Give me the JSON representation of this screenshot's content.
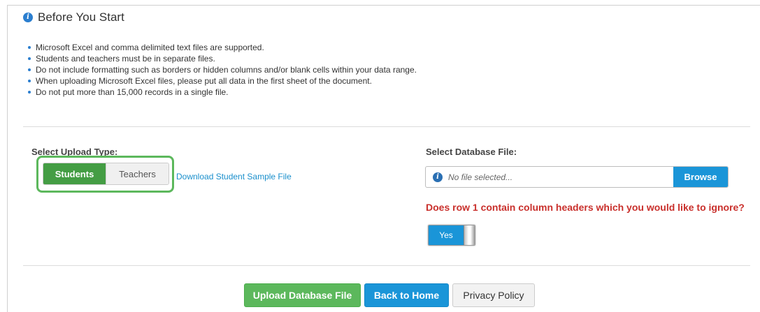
{
  "header": {
    "title": "Before You Start",
    "icon": "info-icon"
  },
  "notes": [
    "Microsoft Excel and comma delimited text files are supported.",
    "Students and teachers must be in separate files.",
    "Do not include formatting such as borders or hidden columns and/or blank cells within your data range.",
    "When uploading Microsoft Excel files, please put all data in the first sheet of the document.",
    "Do not put more than 15,000 records in a single file."
  ],
  "upload_type": {
    "label": "Select Upload Type:",
    "options": [
      "Students",
      "Teachers"
    ],
    "selected": "Students",
    "sample_link": "Download Student Sample File"
  },
  "database_file": {
    "label": "Select Database File:",
    "placeholder": "No file selected...",
    "browse_label": "Browse"
  },
  "header_question": {
    "text": "Does row 1 contain column headers which you would like to ignore?",
    "toggle_value": "Yes"
  },
  "actions": {
    "upload": "Upload Database File",
    "home": "Back to Home",
    "privacy": "Privacy Policy"
  },
  "colors": {
    "green": "#5cb85c",
    "blue": "#1a95d8",
    "red": "#c9302c"
  }
}
